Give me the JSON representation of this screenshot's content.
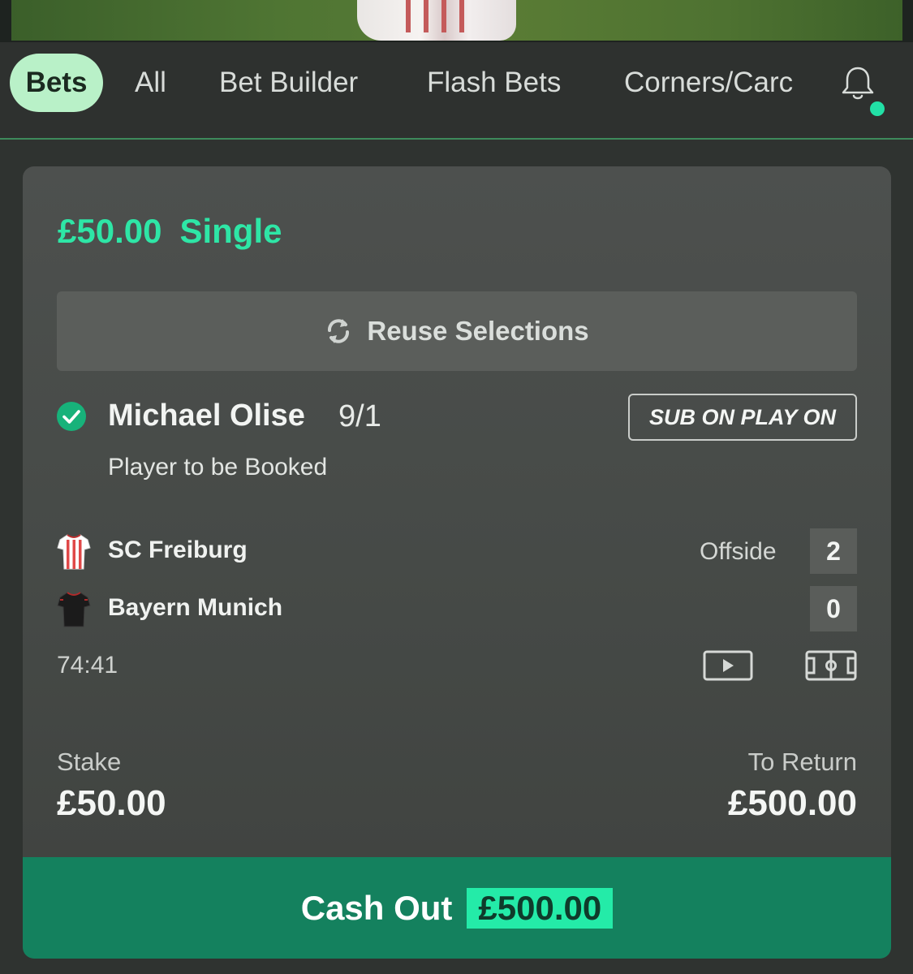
{
  "tabs": [
    {
      "label": "Bets",
      "active": true
    },
    {
      "label": "All"
    },
    {
      "label": "Bet Builder"
    },
    {
      "label": "Flash Bets"
    },
    {
      "label": "Corners/Carc"
    }
  ],
  "notifications": {
    "icon": "bell-icon",
    "has_new": true
  },
  "bet": {
    "stake_amount": "£50.00",
    "type": "Single",
    "reuse_label": "Reuse Selections",
    "selection": {
      "name": "Michael Olise",
      "odds": "9/1",
      "market": "Player to be Booked",
      "badge": "SUB ON PLAY ON",
      "status_icon": "check-circle-icon"
    },
    "match": {
      "stat_label": "Offside",
      "home": {
        "name": "SC Freiburg",
        "score": "2",
        "shirt_icon": "freiburg-shirt-icon"
      },
      "away": {
        "name": "Bayern Munich",
        "score": "0",
        "shirt_icon": "bayern-shirt-icon"
      },
      "clock": "74:41"
    },
    "stake_label": "Stake",
    "stake_value": "£50.00",
    "return_label": "To Return",
    "return_value": "£500.00",
    "cashout_label": "Cash Out",
    "cashout_value": "£500.00"
  },
  "colors": {
    "accent": "#2ee6a6",
    "cashout_bg": "#14815e",
    "active_tab": "#b9f1c8"
  }
}
